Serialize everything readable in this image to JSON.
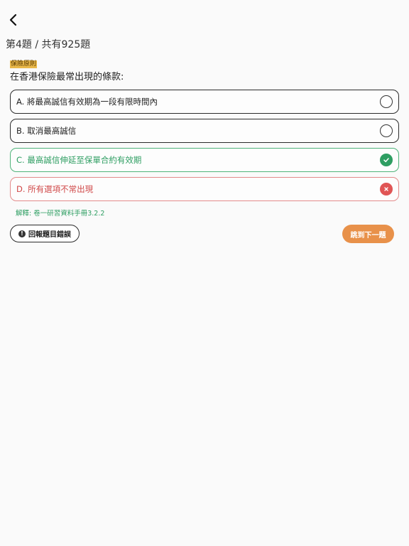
{
  "header": {
    "back_icon": "chevron-left-icon",
    "progress": "第4題 / 共有925題"
  },
  "question": {
    "category": "保險原則",
    "text": "在香港保險最常出現的條款:"
  },
  "options": [
    {
      "label": "A. 將最高誠信有效期為一段有限時間內",
      "state": "unselected"
    },
    {
      "label": "B. 取消最高誠信",
      "state": "unselected"
    },
    {
      "label": "C. 最高誠信伸延至保單合約有效期",
      "state": "correct"
    },
    {
      "label": "D. 所有選項不常出現",
      "state": "wrong"
    }
  ],
  "explanation": "解釋: 卷一研習資料手冊3.2.2",
  "actions": {
    "report_label": "回報題目錯誤",
    "next_label": "跳到下一題"
  },
  "colors": {
    "correct": "#2e9e62",
    "wrong": "#e05555",
    "accent": "#e8914a",
    "category_bg": "#e9b84a"
  }
}
